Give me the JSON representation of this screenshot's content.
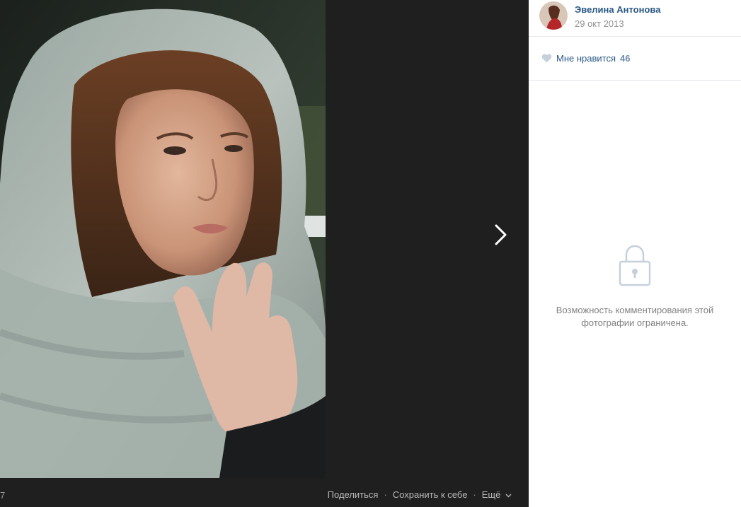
{
  "photo": {
    "counter": "7"
  },
  "toolbar": {
    "share_label": "Поделиться",
    "save_label": "Сохранить к себе",
    "more_label": "Ещё",
    "separator": "·"
  },
  "author": {
    "name": "Эвелина Антонова",
    "date": "29 окт 2013"
  },
  "likes": {
    "label": "Мне нравится",
    "count": "46"
  },
  "comments": {
    "restricted_text": "Возможность комментирования этой фотографии ограничена."
  },
  "icons": {
    "next": "chevron-right-icon",
    "like": "heart-icon",
    "lock": "lock-icon",
    "more": "chevron-down-icon"
  },
  "colors": {
    "viewer_bg": "#1f1f1f",
    "link": "#2a5885",
    "muted": "#939393",
    "icon_light": "#c5d0db"
  }
}
